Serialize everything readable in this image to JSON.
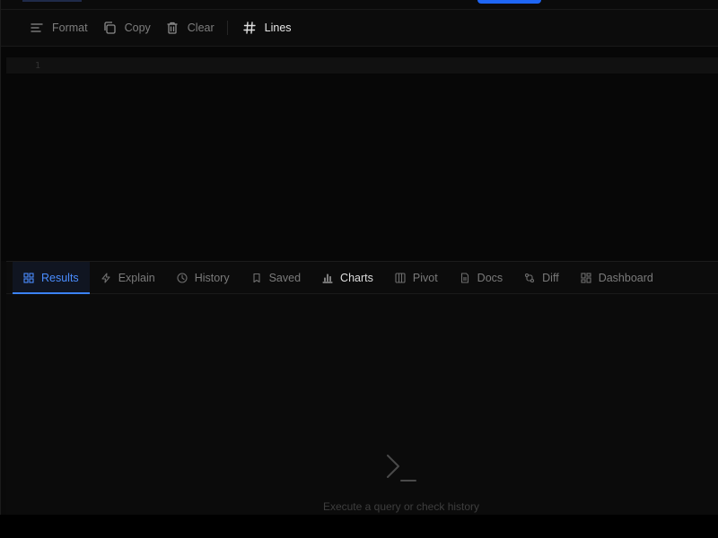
{
  "toolbar": {
    "buttons": [
      {
        "label": "Format",
        "icon": "format-lines-icon"
      },
      {
        "label": "Copy",
        "icon": "copy-icon"
      },
      {
        "label": "Clear",
        "icon": "trash-icon"
      },
      {
        "label": "Lines",
        "icon": "hash-icon"
      }
    ]
  },
  "editor": {
    "line_number": "1"
  },
  "results_tabs": [
    {
      "label": "Results",
      "icon": "grid-icon",
      "active": true
    },
    {
      "label": "Explain",
      "icon": "bolt-icon"
    },
    {
      "label": "History",
      "icon": "clock-icon"
    },
    {
      "label": "Saved",
      "icon": "bookmark-icon"
    },
    {
      "label": "Charts",
      "icon": "bar-chart-icon"
    },
    {
      "label": "Pivot",
      "icon": "columns-icon"
    },
    {
      "label": "Docs",
      "icon": "document-icon"
    },
    {
      "label": "Diff",
      "icon": "diff-icon"
    },
    {
      "label": "Dashboard",
      "icon": "dashboard-icon"
    }
  ],
  "empty_state": {
    "icon": "terminal-prompt-icon",
    "message": "Execute a query or check history"
  },
  "colors": {
    "accent": "#3b82f6",
    "background": "#0a0a0a"
  }
}
